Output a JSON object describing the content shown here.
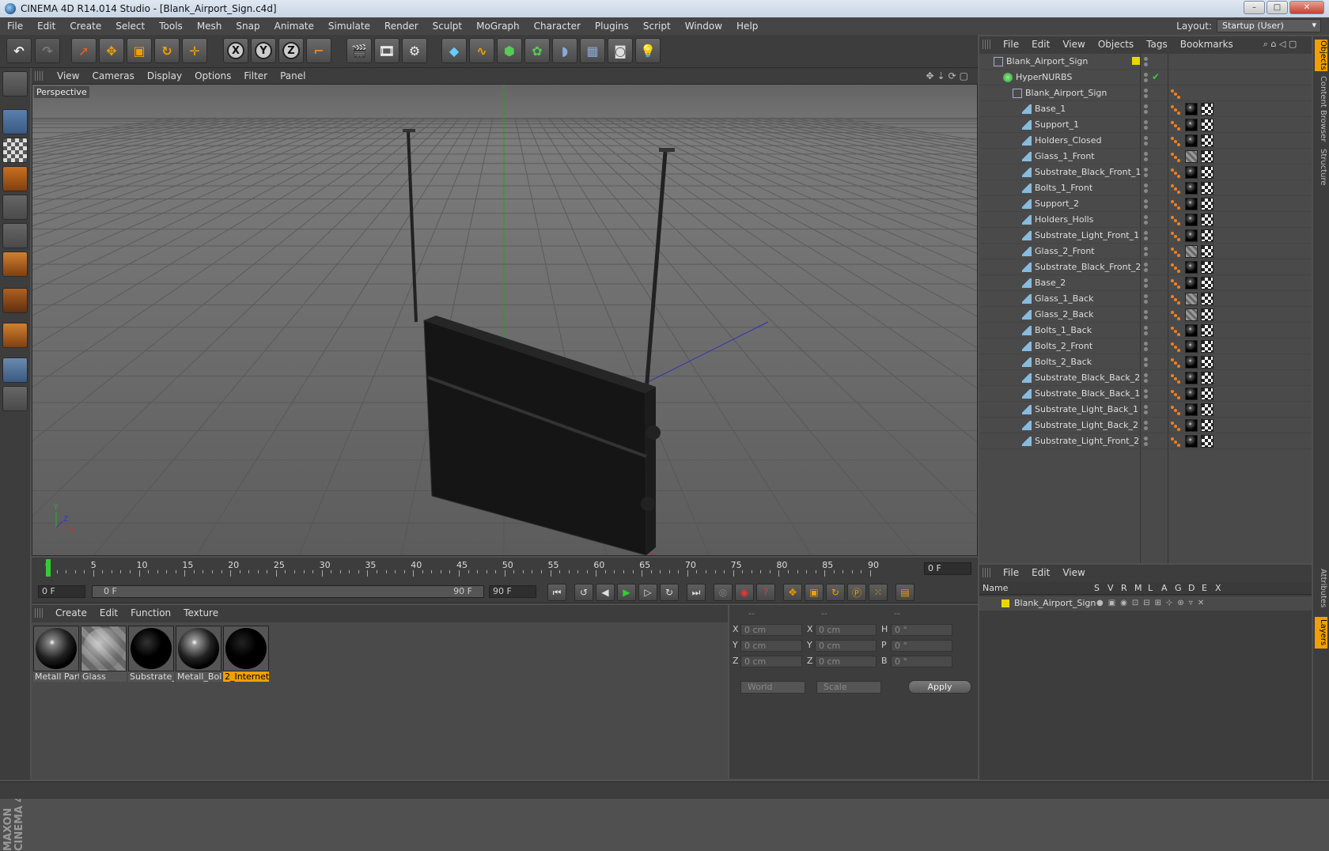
{
  "window": {
    "title": "CINEMA 4D R14.014 Studio - [Blank_Airport_Sign.c4d]"
  },
  "menubar": [
    "File",
    "Edit",
    "Create",
    "Select",
    "Tools",
    "Mesh",
    "Snap",
    "Animate",
    "Simulate",
    "Render",
    "Sculpt",
    "MoGraph",
    "Character",
    "Plugins",
    "Script",
    "Window",
    "Help"
  ],
  "layout": {
    "label": "Layout:",
    "value": "Startup (User)"
  },
  "viewport": {
    "menu": [
      "View",
      "Cameras",
      "Display",
      "Options",
      "Filter",
      "Panel"
    ],
    "label": "Perspective",
    "axis_labels": {
      "y": "Y",
      "z": "Z",
      "x": "X"
    }
  },
  "timeline": {
    "ticks": [
      "0",
      "5",
      "10",
      "15",
      "20",
      "25",
      "30",
      "35",
      "40",
      "45",
      "50",
      "55",
      "60",
      "65",
      "70",
      "75",
      "80",
      "85",
      "90"
    ],
    "current_frame": "0 F"
  },
  "playbar": {
    "start": "0 F",
    "slider_left": "0 F",
    "slider_right": "90 F",
    "end": "90 F"
  },
  "material_manager": {
    "menu": [
      "Create",
      "Edit",
      "Function",
      "Texture"
    ],
    "materials": [
      {
        "name": "Metall Part",
        "kind": "metal"
      },
      {
        "name": "Glass",
        "kind": "glass"
      },
      {
        "name": "Substrate_l",
        "kind": "black"
      },
      {
        "name": "Metall_Bolt",
        "kind": "metal"
      },
      {
        "name": "2_Internet",
        "kind": "black",
        "selected": true
      }
    ]
  },
  "coordinates": {
    "headers": [
      "--",
      "--",
      "--"
    ],
    "rows": [
      {
        "l1": "X",
        "v1": "0 cm",
        "l2": "X",
        "v2": "0 cm",
        "l3": "H",
        "v3": "0 °"
      },
      {
        "l1": "Y",
        "v1": "0 cm",
        "l2": "Y",
        "v2": "0 cm",
        "l3": "P",
        "v3": "0 °"
      },
      {
        "l1": "Z",
        "v1": "0 cm",
        "l2": "Z",
        "v2": "0 cm",
        "l3": "B",
        "v3": "0 °"
      }
    ],
    "space": "World",
    "mode": "Scale",
    "apply": "Apply"
  },
  "object_manager": {
    "menu": [
      "File",
      "Edit",
      "View",
      "Objects",
      "Tags",
      "Bookmarks"
    ],
    "objects": [
      {
        "name": "Blank_Airport_Sign",
        "level": 0,
        "type": "null"
      },
      {
        "name": "HyperNURBS",
        "level": 1,
        "type": "hypernurbs"
      },
      {
        "name": "Blank_Airport_Sign",
        "level": 2,
        "type": "null"
      },
      {
        "name": "Base_1",
        "level": 3,
        "type": "poly"
      },
      {
        "name": "Support_1",
        "level": 3,
        "type": "poly"
      },
      {
        "name": "Holders_Closed",
        "level": 3,
        "type": "poly"
      },
      {
        "name": "Glass_1_Front",
        "level": 3,
        "type": "poly"
      },
      {
        "name": "Substrate_Black_Front_1",
        "level": 3,
        "type": "poly"
      },
      {
        "name": "Bolts_1_Front",
        "level": 3,
        "type": "poly"
      },
      {
        "name": "Support_2",
        "level": 3,
        "type": "poly"
      },
      {
        "name": "Holders_Holls",
        "level": 3,
        "type": "poly"
      },
      {
        "name": "Substrate_Light_Front_1",
        "level": 3,
        "type": "poly"
      },
      {
        "name": "Glass_2_Front",
        "level": 3,
        "type": "poly"
      },
      {
        "name": "Substrate_Black_Front_2",
        "level": 3,
        "type": "poly"
      },
      {
        "name": "Base_2",
        "level": 3,
        "type": "poly"
      },
      {
        "name": "Glass_1_Back",
        "level": 3,
        "type": "poly"
      },
      {
        "name": "Glass_2_Back",
        "level": 3,
        "type": "poly"
      },
      {
        "name": "Bolts_1_Back",
        "level": 3,
        "type": "poly"
      },
      {
        "name": "Bolts_2_Front",
        "level": 3,
        "type": "poly"
      },
      {
        "name": "Bolts_2_Back",
        "level": 3,
        "type": "poly"
      },
      {
        "name": "Substrate_Black_Back_2",
        "level": 3,
        "type": "poly"
      },
      {
        "name": "Substrate_Black_Back_1",
        "level": 3,
        "type": "poly"
      },
      {
        "name": "Substrate_Light_Back_1",
        "level": 3,
        "type": "poly"
      },
      {
        "name": "Substrate_Light_Back_2",
        "level": 3,
        "type": "poly"
      },
      {
        "name": "Substrate_Light_Front_2",
        "level": 3,
        "type": "poly"
      }
    ]
  },
  "layer_manager": {
    "menu": [
      "File",
      "Edit",
      "View"
    ],
    "columns": [
      "Name",
      "S",
      "V",
      "R",
      "M",
      "L",
      "A",
      "G",
      "D",
      "E",
      "X"
    ],
    "layers": [
      {
        "name": "Blank_Airport_Sign",
        "color": "#e8d800"
      }
    ]
  },
  "side_tabs": [
    "Objects",
    "Content Browser",
    "Structure",
    "Attributes",
    "Layers"
  ],
  "colors": {
    "accent": "#f0a000",
    "layer_yellow": "#e8d800"
  }
}
